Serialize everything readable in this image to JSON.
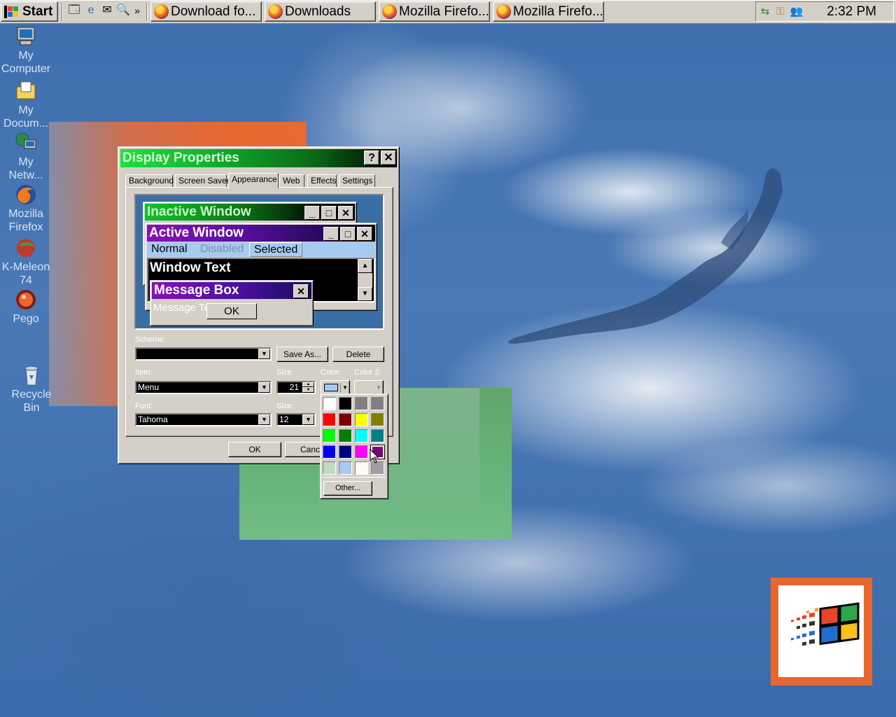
{
  "taskbar": {
    "start_label": "Start",
    "buttons": [
      {
        "label": "Download fo..."
      },
      {
        "label": "Downloads"
      },
      {
        "label": "Mozilla Firefo..."
      },
      {
        "label": "Mozilla Firefo..."
      }
    ],
    "clock": "2:32 PM",
    "chevron": "»"
  },
  "desktop_icons": [
    {
      "label": "My Computer",
      "icon": "my-computer-icon"
    },
    {
      "label": "My Docum...",
      "icon": "my-documents-icon"
    },
    {
      "label": "My Netw...",
      "icon": "my-network-icon"
    },
    {
      "label": "Mozilla Firefox",
      "icon": "firefox-icon"
    },
    {
      "label": "K-Meleon 74",
      "icon": "k-meleon-icon"
    },
    {
      "label": "Pego",
      "icon": "pego-icon"
    },
    {
      "label": "Recycle Bin",
      "icon": "recycle-bin-icon"
    }
  ],
  "dialog": {
    "title": "Display Properties",
    "help_glyph": "?",
    "close_glyph": "✕",
    "tabs": [
      "Background",
      "Screen Saver",
      "Appearance",
      "Web",
      "Effects",
      "Settings"
    ],
    "active_tab": "Appearance",
    "preview": {
      "inactive_title": "Inactive Window",
      "active_title": "Active Window",
      "menu_normal": "Normal",
      "menu_disabled": "Disabled",
      "menu_selected": "Selected",
      "window_text": "Window Text",
      "message_box_title": "Message Box",
      "message_text": "Message Text",
      "ok": "OK"
    },
    "scheme_label": "Scheme:",
    "scheme_value": "",
    "save_as": "Save As...",
    "delete": "Delete",
    "item_label": "Item:",
    "item_value": "Menu",
    "size_label": "Size:",
    "size_value": "21",
    "color_label": "Color:",
    "color2_label": "Color 2:",
    "font_label": "Font:",
    "font_value": "Tahoma",
    "font_size_label": "Size:",
    "font_size_value": "12",
    "ok": "OK",
    "cancel": "Cance"
  },
  "palette": {
    "colors": [
      "#ffffff",
      "#000000",
      "#808080",
      "#808080",
      "#ff0000",
      "#800000",
      "#ffff00",
      "#808000",
      "#00ff00",
      "#008000",
      "#00ffff",
      "#008080",
      "#0000ff",
      "#000080",
      "#ff00ff",
      "#800080",
      "#c0dcc0",
      "#a6caf0",
      "#fffbf0",
      "#a0a0a4"
    ],
    "selected_index": 15,
    "other_label": "Other..."
  },
  "colors": {
    "active_title_start": "#7a00a8",
    "active_title_end": "#000000",
    "inactive_title_start": "#1fe03a",
    "menu_bg": "#a6caf0",
    "selected_preview_color": "#a6caf0"
  }
}
